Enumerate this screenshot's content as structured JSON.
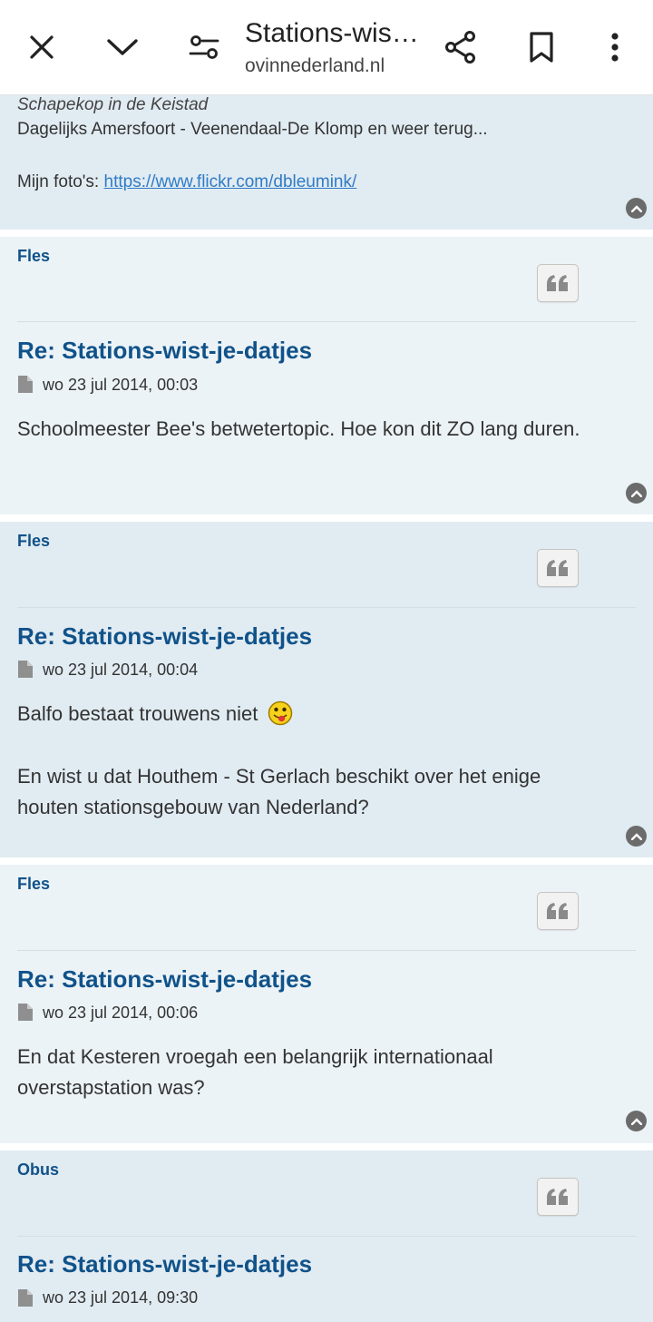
{
  "browser": {
    "title": "Stations-wist-je-datjes",
    "url": "ovinnederland.nl",
    "icons": [
      "close-icon",
      "chevron-down-icon",
      "site-settings-icon",
      "share-icon",
      "bookmark-icon",
      "more-vert-icon"
    ]
  },
  "signature": {
    "line1": "Schapekop in de Keistad",
    "line2": "Dagelijks Amersfoort - Veenendaal-De Klomp en weer terug...",
    "photos_label": "Mijn foto's: ",
    "photos_link": "https://www.flickr.com/dbleumink/"
  },
  "posts": [
    {
      "author": "Fles",
      "title": "Re: Stations-wist-je-datjes",
      "date": "wo 23 jul 2014, 00:03",
      "text1": "Schoolmeester Bee's betwetertopic. Hoe kon dit ZO lang duren."
    },
    {
      "author": "Fles",
      "title": "Re: Stations-wist-je-datjes",
      "date": "wo 23 jul 2014, 00:04",
      "text1": "Balfo bestaat trouwens niet",
      "text2a": "En wist u dat Houthem - St Gerlach beschikt over het enige",
      "text2b": "houten stationsgebouw van Nederland?"
    },
    {
      "author": "Fles",
      "title": "Re: Stations-wist-je-datjes",
      "date": "wo 23 jul 2014, 00:06",
      "text1a": "En dat Kesteren vroegah een belangrijk internationaal",
      "text1b": "overstapstation was?"
    },
    {
      "author": "Obus",
      "title": "Re: Stations-wist-je-datjes",
      "date": "wo 23 jul 2014, 09:30"
    }
  ],
  "colors": {
    "post_bg_dark": "#e1ebf2",
    "post_bg_light": "#ecf3f7",
    "link_blue": "#105289"
  }
}
